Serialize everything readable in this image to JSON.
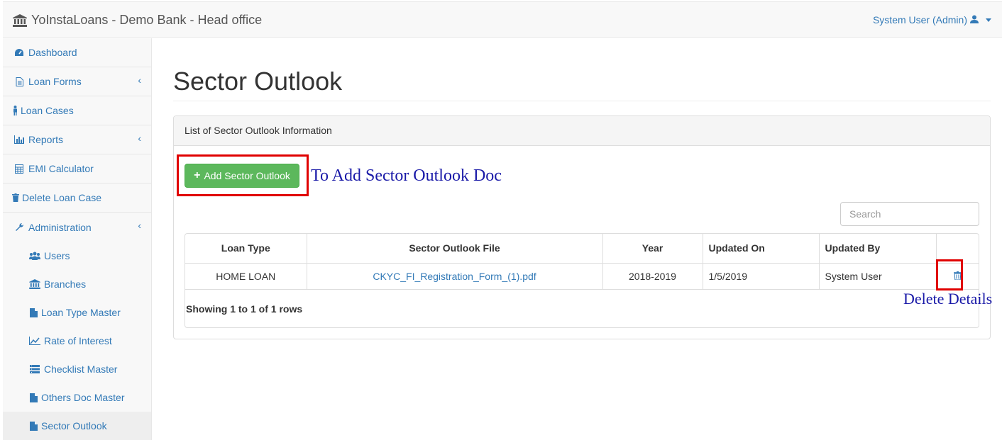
{
  "app": {
    "title": "YoInstaLoans - Demo Bank - Head office",
    "user": "System User (Admin)"
  },
  "sidebar": {
    "items": [
      {
        "label": "Dashboard",
        "icon": "dashboard-icon"
      },
      {
        "label": "Loan Forms",
        "icon": "file-icon",
        "expandable": true
      },
      {
        "label": "Loan Cases",
        "icon": "person-icon"
      },
      {
        "label": "Reports",
        "icon": "bar-chart-icon",
        "expandable": true
      },
      {
        "label": "EMI Calculator",
        "icon": "calculator-icon"
      },
      {
        "label": "Delete Loan Case",
        "icon": "trash-icon"
      },
      {
        "label": "Administration",
        "icon": "wrench-icon",
        "expandable": true
      }
    ],
    "subitems": [
      {
        "label": "Users",
        "icon": "users-icon"
      },
      {
        "label": "Branches",
        "icon": "bank-icon"
      },
      {
        "label": "Loan Type Master",
        "icon": "file-icon"
      },
      {
        "label": "Rate of Interest",
        "icon": "line-chart-icon"
      },
      {
        "label": "Checklist Master",
        "icon": "list-icon"
      },
      {
        "label": "Others Doc Master",
        "icon": "file-icon"
      },
      {
        "label": "Sector Outlook",
        "icon": "file-icon",
        "active": true
      }
    ]
  },
  "main": {
    "title": "Sector Outlook",
    "panel_heading": "List of Sector Outlook Information",
    "add_button": "Add Sector Outlook",
    "add_annotation": "To Add Sector Outlook Doc",
    "delete_annotation": "Delete Details",
    "search_placeholder": "Search",
    "table": {
      "headers": [
        "Loan Type",
        "Sector Outlook File",
        "Year",
        "Updated On",
        "Updated By",
        ""
      ],
      "rows": [
        {
          "loan_type": "HOME LOAN",
          "file": "CKYC_FI_Registration_Form_(1).pdf",
          "year": "2018-2019",
          "updated_on": "1/5/2019",
          "updated_by": "System User"
        }
      ]
    },
    "showing": "Showing 1 to 1 of 1 rows"
  },
  "colors": {
    "accent": "#337ab7",
    "success": "#5cb85c",
    "annotation_red": "#e00000",
    "annotation_text": "#1a1aa8"
  }
}
